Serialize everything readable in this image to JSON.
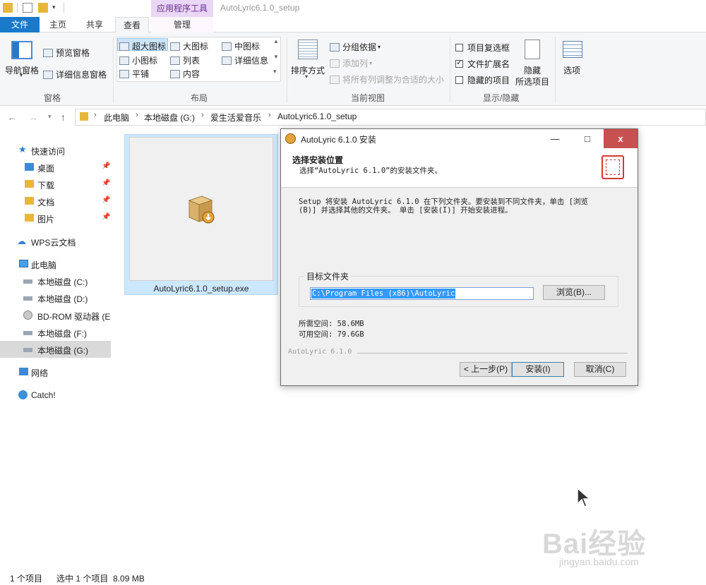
{
  "titlebar": {
    "context_tab_label": "应用程序工具",
    "window_title": "AutoLyric6.1.0_setup"
  },
  "ribbon_tabs": {
    "file": "文件",
    "home": "主页",
    "share": "共享",
    "view": "查看",
    "manage": "管理"
  },
  "ribbon": {
    "pane_group": {
      "nav_pane": "导航窗格",
      "preview_pane": "预览窗格",
      "details_pane": "详细信息窗格",
      "label": "窗格"
    },
    "layout_group": {
      "items": [
        "超大图标",
        "大图标",
        "中图标",
        "小图标",
        "列表",
        "详细信息",
        "平铺",
        "内容"
      ],
      "label": "布局"
    },
    "current_view_group": {
      "sort_by": "排序方式",
      "group_by": "分组依据",
      "add_columns": "添加列",
      "fit_columns": "将所有列调整为合适的大小",
      "label": "当前视图"
    },
    "show_hide_group": {
      "item_checkboxes": "项目复选框",
      "item_checkboxes_checked": false,
      "file_extensions": "文件扩展名",
      "file_extensions_checked": true,
      "hidden_items": "隐藏的项目",
      "hidden_items_checked": false,
      "hide_selected": "隐藏",
      "hide_selected_line2": "所选项目",
      "label": "显示/隐藏"
    },
    "options": "选项"
  },
  "address": {
    "crumbs": [
      "此电脑",
      "本地磁盘 (G:)",
      "爱生活爱音乐",
      "AutoLyric6.1.0_setup"
    ]
  },
  "nav_pane": {
    "quick_access": "快速访问",
    "desktop": "桌面",
    "downloads": "下载",
    "documents": "文档",
    "pictures": "图片",
    "wps_cloud": "WPS云文档",
    "this_pc": "此电脑",
    "drive_c": "本地磁盘 (C:)",
    "drive_d": "本地磁盘 (D:)",
    "drive_e": "BD-ROM 驱动器 (E",
    "drive_f": "本地磁盘 (F:)",
    "drive_g": "本地磁盘 (G:)",
    "network": "网络",
    "catch": "Catch!"
  },
  "file": {
    "name": "AutoLyric6.1.0_setup.exe"
  },
  "status": {
    "count": "1 个项目",
    "selected": "选中 1 个项目  8.09 MB"
  },
  "dialog": {
    "title": "AutoLyric 6.1.0 安装",
    "minimize": "—",
    "maximize": "□",
    "close": "x",
    "header_title": "选择安装位置",
    "header_sub": "选择“AutoLyric 6.1.0”的安装文件夹。",
    "body_line1": "Setup 将安装 AutoLyric 6.1.0 在下列文件夹。要安装到不同文件夹，单击 [浏览",
    "body_line2": "(B)] 并选择其他的文件夹。 单击 [安装(I)] 开始安装进程。",
    "dest_label": "目标文件夹",
    "dest_path": "C:\\Program Files (x86)\\AutoLyric",
    "browse": "浏览(B)...",
    "space_required": "所需空间: 58.6MB",
    "space_available": "可用空间: 79.6GB",
    "brand": "AutoLyric 6.1.0",
    "back": "< 上一步(P)",
    "install": "安装(I)",
    "cancel": "取消(C)"
  },
  "watermark": {
    "main": "Bai经验",
    "sub": "jingyan.baidu.com"
  }
}
